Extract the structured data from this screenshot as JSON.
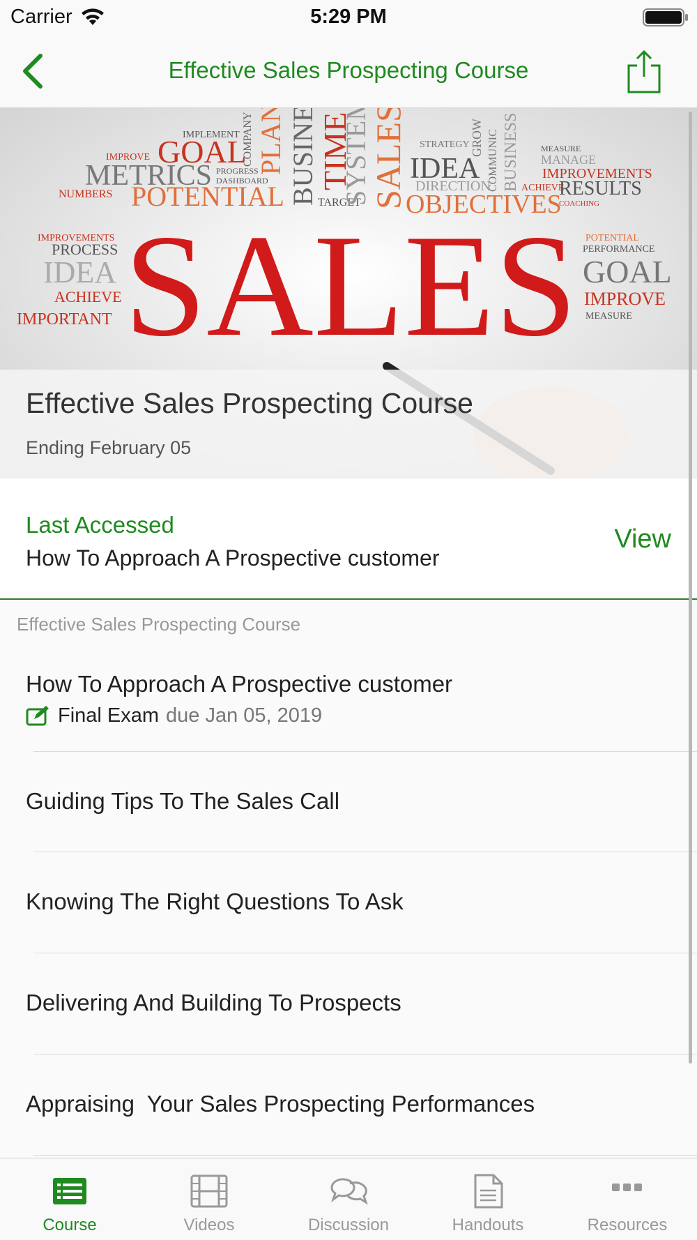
{
  "colors": {
    "accent": "#1f8a1f",
    "inactive": "#999999",
    "sales_red": "#d11a1a"
  },
  "status_bar": {
    "carrier": "Carrier",
    "time": "5:29 PM"
  },
  "nav": {
    "title": "Effective Sales Prospecting Course",
    "back_icon": "chevron-left-icon",
    "share_icon": "share-icon"
  },
  "hero": {
    "image_words": {
      "main": "SALES",
      "top": [
        "IMPLEMENT",
        "GOAL",
        "METRICS",
        "IMPROVE",
        "NUMBERS",
        "POTENTIAL",
        "COMPANY",
        "PLAN",
        "PROGRESS",
        "DASHBOARD",
        "BUSINE",
        "TIME",
        "TARGET",
        "SYSTEM",
        "SALES",
        "STRATEGY",
        "IDEA",
        "DIRECTION",
        "OBJECTIVES",
        "GROW",
        "COMMUNIC",
        "BUSINESS",
        "MEASURE",
        "MANAGE",
        "IMPROVEMENTS",
        "ACHIEVE",
        "RESULTS",
        "COACHING"
      ],
      "left": [
        "IMPROVEMENTS",
        "PROCESS",
        "IDEA",
        "ACHIEVE",
        "IMPORTANT"
      ],
      "right": [
        "POTENTIAL",
        "PERFORMANCE",
        "GOAL",
        "IMPROVE",
        "MEASURE"
      ]
    },
    "title": "Effective Sales Prospecting Course",
    "subtitle": "Ending February 05"
  },
  "last_accessed": {
    "label": "Last Accessed",
    "item": "How To Approach A Prospective customer",
    "action": "View"
  },
  "section": {
    "header": "Effective Sales Prospecting Course",
    "lessons": [
      {
        "title": "How To Approach A Prospective customer",
        "exam": {
          "name": "Final Exam",
          "due": "due Jan 05, 2019",
          "icon": "edit-icon"
        }
      },
      {
        "title": "Guiding Tips To The Sales Call"
      },
      {
        "title": "Knowing The Right Questions To Ask"
      },
      {
        "title": "Delivering And Building To Prospects"
      },
      {
        "title": "Appraising  Your Sales Prospecting Performances"
      }
    ]
  },
  "tabs": [
    {
      "label": "Course",
      "icon": "course-list-icon",
      "active": true
    },
    {
      "label": "Videos",
      "icon": "film-icon",
      "active": false
    },
    {
      "label": "Discussion",
      "icon": "chat-bubbles-icon",
      "active": false
    },
    {
      "label": "Handouts",
      "icon": "document-icon",
      "active": false
    },
    {
      "label": "Resources",
      "icon": "more-dots-icon",
      "active": false
    }
  ]
}
